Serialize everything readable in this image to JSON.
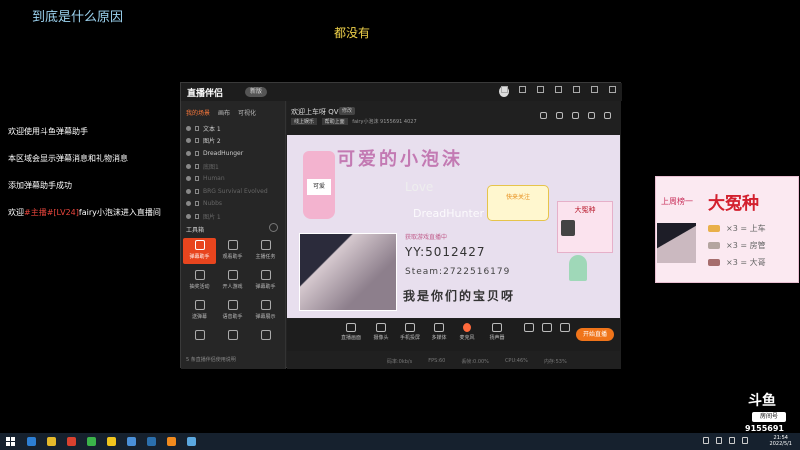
{
  "overlay": {
    "title": "到底是什么原因",
    "subtitle": "都没有"
  },
  "chat": {
    "lines": [
      "欢迎使用斗鱼弹幕助手",
      "本区域会显示弹幕消息和礼物消息",
      "添加弹幕助手成功"
    ],
    "welcome_prefix": "欢迎",
    "welcome_role": "#主播#[LV24]",
    "welcome_user": "fairy小泡沫进入直播间"
  },
  "app": {
    "logo": "直播伴侣",
    "badge": "新版",
    "tabs": [
      "我的场景",
      "画布",
      "可视化"
    ],
    "layers": [
      {
        "name": "文本 1",
        "dim": false
      },
      {
        "name": "图片 2",
        "dim": false
      },
      {
        "name": "DreadHunger",
        "dim": false
      },
      {
        "name": "底图1",
        "dim": true
      },
      {
        "name": "Human",
        "dim": true
      },
      {
        "name": "BRG Survival Evolved",
        "dim": true
      },
      {
        "name": "Nubbs",
        "dim": true
      },
      {
        "name": "图片 1",
        "dim": true
      }
    ],
    "tools_header": "工具箱",
    "tools": [
      "弹幕助手",
      "观看助手",
      "主播任务",
      "抽奖活动",
      "开人游戏",
      "弹幕助手",
      "送弹幕",
      "语音助手",
      "弹幕展示",
      "",
      "",
      ""
    ],
    "footer": "5 条直播伴侣使用说明",
    "room": {
      "title": "欢迎上车呀 QVQ",
      "edit": "修改",
      "chips": [
        "线上娱乐",
        "帮助上面"
      ],
      "host": "fairy小泡沫",
      "room_id": "9155691",
      "fans": "4027"
    },
    "preview": {
      "banner": "可爱的小泡沫",
      "bottle_label": "可爱",
      "cursive": "Love",
      "sticker": "快来关注",
      "card_title": "大冤种",
      "live_note": "获取游戏直播中",
      "yy": "YY:5012427",
      "qq": "Steam:2722516179",
      "slogan": "我是你们的宝贝呀",
      "watermark": "DreadHunter"
    },
    "controls": [
      "直播画面",
      "摄像头",
      "手机投屏",
      "多媒体",
      "麦克风",
      "扬声器"
    ],
    "go_live": "开始直播",
    "stats": [
      "码率:0kb/s",
      "FPS:60",
      "丢帧:0.00%",
      "CPU:46%",
      "内存:53%"
    ]
  },
  "side_card": {
    "top": "上周榜一",
    "title": "大冤种",
    "rows": [
      {
        "label": "×3 = 上车",
        "color": "#e9b04a"
      },
      {
        "label": "×3 = 房管",
        "color": "#b4a5a0"
      },
      {
        "label": "×3 = 大哥",
        "color": "#a66d6d"
      }
    ]
  },
  "watermark": {
    "logo": "斗鱼",
    "room_label": "房间号",
    "room_number": "9155691"
  },
  "taskbar": {
    "time": "21:54",
    "date": "2022/5/1",
    "icons": [
      "#2d7fd4",
      "#e5b92b",
      "#d9412f",
      "#3bb34a",
      "#f0c41e",
      "#4a90d9",
      "#2b6fad",
      "#f08a1e",
      "#5ba8e0"
    ]
  }
}
